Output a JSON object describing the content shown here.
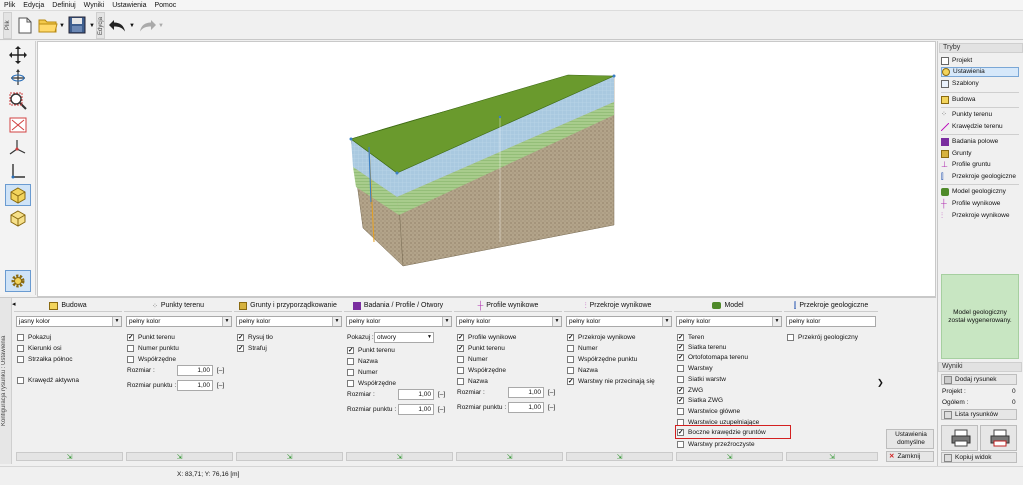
{
  "menu": [
    "Plik",
    "Edycja",
    "Definiuj",
    "Wyniki",
    "Ustawienia",
    "Pomoc"
  ],
  "toolbar": {
    "file_label": "Plik",
    "edit_label": "Edycja"
  },
  "right_panel": {
    "modes_header": "Tryby",
    "modes": [
      {
        "label": "Projekt",
        "icon": "document-icon"
      },
      {
        "label": "Ustawienia",
        "icon": "gear-icon",
        "active": true
      },
      {
        "label": "Szablony",
        "icon": "template-icon"
      },
      {
        "label": "Budowa",
        "icon": "building-icon"
      },
      {
        "label": "Punkty terenu",
        "icon": "points-icon"
      },
      {
        "label": "Krawędzie terenu",
        "icon": "edge-icon"
      },
      {
        "label": "Badania polowe",
        "icon": "drill-icon"
      },
      {
        "label": "Grunty",
        "icon": "soil-icon"
      },
      {
        "label": "Profile gruntu",
        "icon": "profile-icon"
      },
      {
        "label": "Przekroje geologiczne",
        "icon": "section-icon"
      },
      {
        "label": "Model geologiczny",
        "icon": "model-icon"
      },
      {
        "label": "Profile wynikowe",
        "icon": "result-profile-icon"
      },
      {
        "label": "Przekroje wynikowe",
        "icon": "result-section-icon"
      }
    ],
    "message": "Model geologiczny został wygenerowany.",
    "results_header": "Wyniki",
    "add_figure": "Dodaj rysunek",
    "project_label": "Projekt :",
    "project_count": "0",
    "total_label": "Ogółem :",
    "total_count": "0",
    "figure_list": "Lista rysunków",
    "copy_view": "Kopiuj widok"
  },
  "bottom": {
    "side_tab": "Konfiguracja rysunku : Ustawienia",
    "columns": [
      {
        "title": "Budowa",
        "select": "jasny kolor",
        "checks": [
          {
            "label": "Pokazuj",
            "checked": false
          },
          {
            "label": "Kierunki osi",
            "checked": false
          },
          {
            "label": "Strzałka północ",
            "checked": false
          },
          {
            "label": "",
            "checked": null
          },
          {
            "label": "Krawędź aktywna",
            "checked": false
          }
        ]
      },
      {
        "title": "Punkty terenu",
        "select": "pełny kolor",
        "checks": [
          {
            "label": "Punkt terenu",
            "checked": true
          },
          {
            "label": "Numer punktu",
            "checked": false
          },
          {
            "label": "Współrzędne",
            "checked": false
          }
        ],
        "nums": [
          {
            "label": "Rozmiar :",
            "value": "1,00",
            "unit": "[–]"
          },
          {
            "label": "Rozmiar punktu :",
            "value": "1,00",
            "unit": "[–]"
          }
        ]
      },
      {
        "title": "Grunty i przyporządkowanie",
        "select": "pełny kolor",
        "checks": [
          {
            "label": "Rysuj tło",
            "checked": true
          },
          {
            "label": "Strafuj",
            "checked": true
          }
        ]
      },
      {
        "title": "Badania / Profile / Otwory",
        "select": "pełny kolor",
        "show_label": "Pokazuj :",
        "show_value": "otwory",
        "checks": [
          {
            "label": "Punkt terenu",
            "checked": true
          },
          {
            "label": "Nazwa",
            "checked": false
          },
          {
            "label": "Numer",
            "checked": false
          },
          {
            "label": "Współrzędne",
            "checked": false
          }
        ],
        "nums": [
          {
            "label": "Rozmiar :",
            "value": "1,00",
            "unit": "[–]"
          },
          {
            "label": "Rozmiar punktu :",
            "value": "1,00",
            "unit": "[–]"
          }
        ]
      },
      {
        "title": "Profile wynikowe",
        "select": "pełny kolor",
        "checks": [
          {
            "label": "Profile wynikowe",
            "checked": true
          },
          {
            "label": "Punkt terenu",
            "checked": true
          },
          {
            "label": "Numer",
            "checked": false
          },
          {
            "label": "Współrzędne",
            "checked": false
          },
          {
            "label": "Nazwa",
            "checked": false
          }
        ],
        "nums": [
          {
            "label": "Rozmiar :",
            "value": "1,00",
            "unit": "[–]"
          },
          {
            "label": "Rozmiar punktu :",
            "value": "1,00",
            "unit": "[–]"
          }
        ]
      },
      {
        "title": "Przekroje wynikowe",
        "select": "pełny kolor",
        "checks": [
          {
            "label": "Przekroje wynikowe",
            "checked": true
          },
          {
            "label": "Numer",
            "checked": false
          },
          {
            "label": "Współrzędne punktu",
            "checked": false
          },
          {
            "label": "Nazwa",
            "checked": false
          },
          {
            "label": "Warstwy nie przecinają się",
            "checked": true
          }
        ]
      },
      {
        "title": "Model",
        "select": "pełny kolor",
        "checks": [
          {
            "label": "Teren",
            "checked": true
          },
          {
            "label": "Siatka terenu",
            "checked": true
          },
          {
            "label": "Ortofotomapa terenu",
            "checked": true
          },
          {
            "label": "Warstwy",
            "checked": false
          },
          {
            "label": "Siatki warstw",
            "checked": false
          },
          {
            "label": "ZWG",
            "checked": true
          },
          {
            "label": "Siatka ZWG",
            "checked": true
          },
          {
            "label": "Warstwice główne",
            "checked": false
          },
          {
            "label": "Warstwice uzupełniające",
            "checked": false
          },
          {
            "label": "Boczne krawędzie gruntów",
            "checked": true
          },
          {
            "label": "Warstwy przeźroczyste",
            "checked": false
          }
        ]
      },
      {
        "title": "Przekroje geologiczne",
        "select": "pełny kolor",
        "checks": [
          {
            "label": "Przekrój geologiczny",
            "checked": false
          }
        ]
      }
    ],
    "defaults_button": "Ustawienia domyślne",
    "close_button": "Zamknij"
  },
  "status": {
    "coords": "X: 83,71; Y: 76,16 [m]"
  },
  "colors": {
    "highlight": "#d32020",
    "message_bg": "#c8e6c2",
    "active_mode": "#d6e8fa"
  }
}
